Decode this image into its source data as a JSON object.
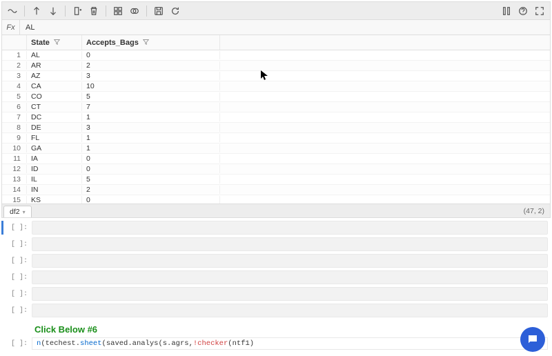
{
  "fx": {
    "label": "Fx",
    "value": "AL"
  },
  "columns": {
    "state": "State",
    "bags": "Accepts_Bags"
  },
  "rows": [
    {
      "n": "1",
      "state": "AL",
      "bags": "0"
    },
    {
      "n": "2",
      "state": "AR",
      "bags": "2"
    },
    {
      "n": "3",
      "state": "AZ",
      "bags": "3"
    },
    {
      "n": "4",
      "state": "CA",
      "bags": "10"
    },
    {
      "n": "5",
      "state": "CO",
      "bags": "5"
    },
    {
      "n": "6",
      "state": "CT",
      "bags": "7"
    },
    {
      "n": "7",
      "state": "DC",
      "bags": "1"
    },
    {
      "n": "8",
      "state": "DE",
      "bags": "3"
    },
    {
      "n": "9",
      "state": "FL",
      "bags": "1"
    },
    {
      "n": "10",
      "state": "GA",
      "bags": "1"
    },
    {
      "n": "11",
      "state": "IA",
      "bags": "0"
    },
    {
      "n": "12",
      "state": "ID",
      "bags": "0"
    },
    {
      "n": "13",
      "state": "IL",
      "bags": "5"
    },
    {
      "n": "14",
      "state": "IN",
      "bags": "2"
    },
    {
      "n": "15",
      "state": "KS",
      "bags": "0"
    }
  ],
  "tab": {
    "name": "df2"
  },
  "dims": "(47, 2)",
  "prompts": [
    "[ ]:",
    "[ ]:",
    "[ ]:",
    "[ ]:",
    "[ ]:",
    "[ ]:"
  ],
  "heading": "Click Below #6",
  "code_prompt": "[ ]:",
  "code_frag": "n(techest.sheet(saved.analys(s.agrs,!checker(ntf1)"
}
